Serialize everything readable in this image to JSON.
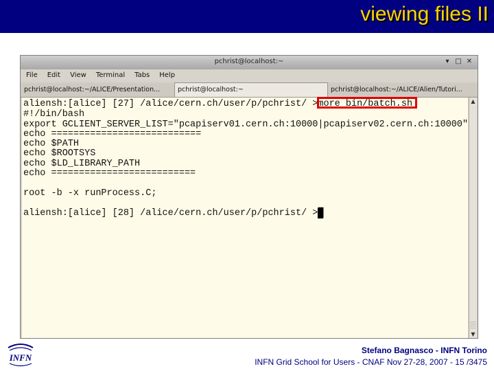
{
  "slide": {
    "title": "viewing files II",
    "footer_author": "Stefano Bagnasco - INFN Torino",
    "footer_event": "INFN Grid School for Users - CNAF Nov 27-28, 2007 - 15 /3475",
    "logo_text": "INFN"
  },
  "window": {
    "title": "pchrist@localhost:~",
    "buttons": [
      "▾",
      "□",
      "✕"
    ],
    "menu": [
      "File",
      "Edit",
      "View",
      "Terminal",
      "Tabs",
      "Help"
    ],
    "tabs": [
      "pchrist@localhost:~/ALICE/Presentation...",
      "pchrist@localhost:~",
      "pchrist@localhost:~/ALICE/Alien/Tutori..."
    ]
  },
  "terminal": {
    "lines": [
      "aliensh:[alice] [27] /alice/cern.ch/user/p/pchrist/ >more bin/batch.sh",
      "#!/bin/bash",
      "export GCLIENT_SERVER_LIST=\"pcapiserv01.cern.ch:10000|pcapiserv02.cern.ch:10000\"",
      "echo ===========================",
      "echo $PATH",
      "echo $ROOTSYS",
      "echo $LD_LIBRARY_PATH",
      "echo ==========================",
      "",
      "root -b -x runProcess.C;",
      "",
      "aliensh:[alice] [28] /alice/cern.ch/user/p/pchrist/ >"
    ],
    "highlighted_command": "more bin/batch.sh"
  },
  "colors": {
    "header_bg": "#000080",
    "title_color": "#ffd400",
    "terminal_bg": "#fefbe8",
    "highlight": "#e00000",
    "footer_text": "#000080"
  }
}
